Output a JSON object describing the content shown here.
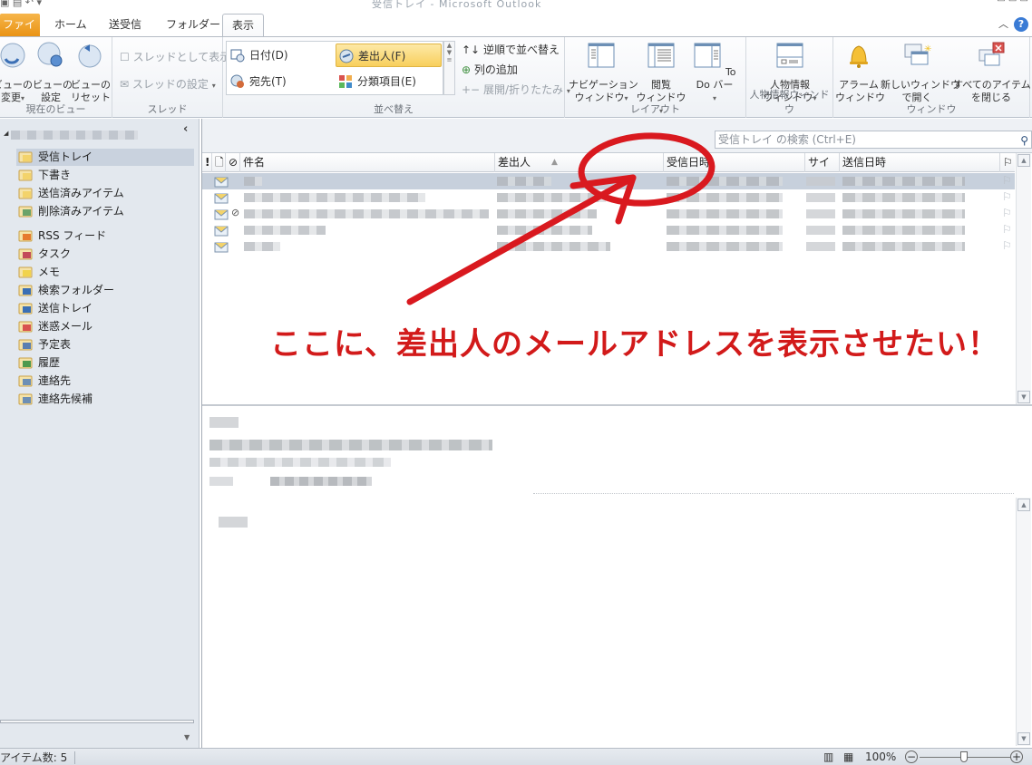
{
  "window": {
    "title": "受信トレイ - Microsoft Outlook"
  },
  "tabs": [
    {
      "label": "ファイル",
      "active": false
    },
    {
      "label": "ホーム",
      "active": false
    },
    {
      "label": "送受信",
      "active": false
    },
    {
      "label": "フォルダー",
      "active": false
    },
    {
      "label": "表示",
      "active": true
    }
  ],
  "ribbon": {
    "current_view": {
      "group_label": "現在のビュー",
      "change_view": "ビューの\n変更",
      "view_settings": "ビューの\n設定",
      "reset_view": "ビューの\nリセット"
    },
    "thread": {
      "group_label": "スレッド",
      "show_as_thread": "スレッドとして表示",
      "thread_settings": "スレッドの設定"
    },
    "arrangement": {
      "group_label": "並べ替え",
      "date": "日付(D)",
      "from": "差出人(F)",
      "to": "宛先(T)",
      "categories": "分類項目(E)",
      "reverse_sort": "逆順で並べ替え",
      "add_column": "列の追加",
      "expand_collapse": "展開/折りたたみ"
    },
    "layout": {
      "group_label": "レイアウト",
      "navigation_pane": "ナビゲーション\nウィンドウ",
      "reading_pane": "閲覧\nウィンドウ",
      "todo_bar": "To Do バー"
    },
    "people_pane": {
      "group_label": "人物情報ウィンドウ",
      "people_pane": "人物情報\nウィンドウ"
    },
    "window": {
      "group_label": "ウィンドウ",
      "reminders": "アラーム\nウィンドウ",
      "open_new_window": "新しいウィンドウ\nで開く",
      "close_all_items": "すべてのアイテム\nを閉じる"
    }
  },
  "navigation": {
    "folders": [
      {
        "label": "受信トレイ",
        "icon": "inbox-icon",
        "selected": true
      },
      {
        "label": "下書き",
        "icon": "drafts-icon"
      },
      {
        "label": "送信済みアイテム",
        "icon": "sent-items-icon"
      },
      {
        "label": "削除済みアイテム",
        "icon": "deleted-items-icon"
      },
      {
        "label": "RSS フィード",
        "icon": "rss-icon"
      },
      {
        "label": "タスク",
        "icon": "tasks-icon"
      },
      {
        "label": "メモ",
        "icon": "notes-icon"
      },
      {
        "label": "検索フォルダー",
        "icon": "search-folder-icon"
      },
      {
        "label": "送信トレイ",
        "icon": "outbox-icon"
      },
      {
        "label": "迷惑メール",
        "icon": "junk-mail-icon"
      },
      {
        "label": "予定表",
        "icon": "calendar-icon"
      },
      {
        "label": "履歴",
        "icon": "journal-icon"
      },
      {
        "label": "連絡先",
        "icon": "contacts-icon"
      },
      {
        "label": "連絡先候補",
        "icon": "suggested-contacts-icon"
      }
    ]
  },
  "search": {
    "placeholder": "受信トレイ の検索 (Ctrl+E)"
  },
  "message_list": {
    "columns": {
      "importance": "!",
      "icon": "",
      "attachment": "",
      "subject": "件名",
      "from": "差出人",
      "received": "受信日時",
      "size": "サイズ",
      "sent": "送信日時"
    },
    "row_count": 5
  },
  "annotation": {
    "text": "ここに、差出人のメールアドレスを表示させたい！",
    "color": "#d21a1a"
  },
  "status": {
    "item_count": "アイテム数: 5",
    "zoom": "100%"
  }
}
